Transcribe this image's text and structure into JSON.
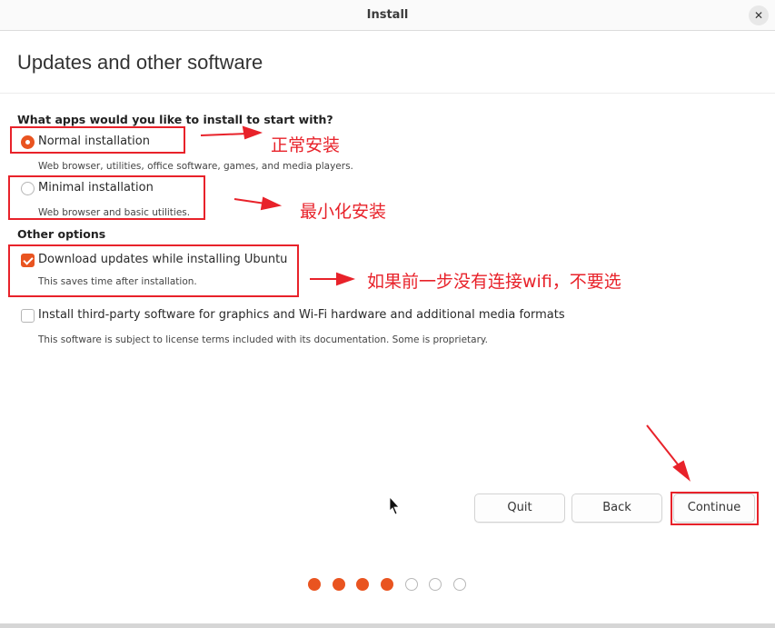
{
  "window": {
    "title": "Install",
    "close_symbol": "✕"
  },
  "heading": "Updates and other software",
  "apps_section": {
    "title": "What apps would you like to install to start with?",
    "options": [
      {
        "label": "Normal installation",
        "description": "Web browser, utilities, office software, games, and media players.",
        "selected": true
      },
      {
        "label": "Minimal installation",
        "description": "Web browser and basic utilities.",
        "selected": false
      }
    ]
  },
  "other_section": {
    "title": "Other options",
    "options": [
      {
        "label": "Download updates while installing Ubuntu",
        "description": "This saves time after installation.",
        "checked": true
      },
      {
        "label": "Install third-party software for graphics and Wi-Fi hardware and additional media formats",
        "description": "This software is subject to license terms included with its documentation. Some is proprietary.",
        "checked": false
      }
    ]
  },
  "buttons": {
    "quit": "Quit",
    "back": "Back",
    "continue": "Continue"
  },
  "progress": {
    "total_steps": 7,
    "current_step": 4
  },
  "annotations": {
    "normal": "正常安装",
    "minimal": "最小化安装",
    "updates": "如果前一步没有连接wifi，不要选"
  },
  "colors": {
    "accent": "#e95420",
    "annotation": "#e8222a"
  }
}
